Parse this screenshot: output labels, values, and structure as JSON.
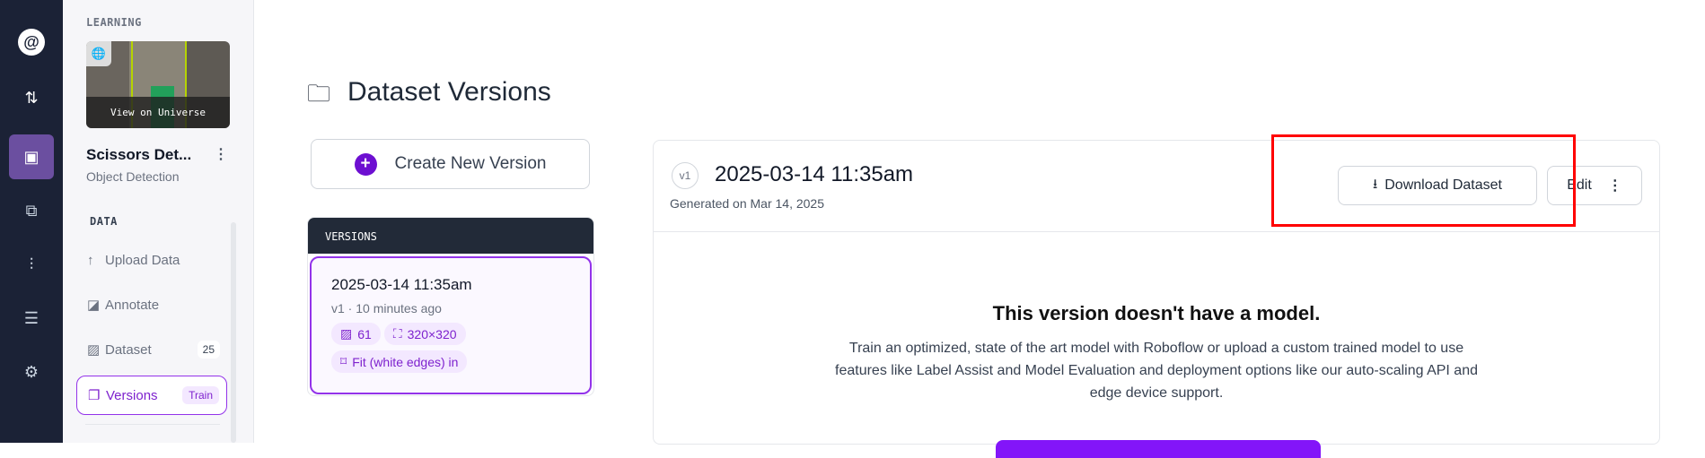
{
  "rail": {
    "items": [
      {
        "name": "logo-icon",
        "glyph": "@"
      },
      {
        "name": "upload-download-icon",
        "glyph": "⇅"
      },
      {
        "name": "data-icon",
        "glyph": "▣"
      },
      {
        "name": "workflow-icon",
        "glyph": "⧉"
      },
      {
        "name": "analytics-icon",
        "glyph": "⫶"
      },
      {
        "name": "storage-icon",
        "glyph": "☰"
      },
      {
        "name": "settings-icon",
        "glyph": "⚙"
      }
    ]
  },
  "panel": {
    "section_learning": "LEARNING",
    "thumb_caption": "View on Universe",
    "project_name": "Scissors Det...",
    "project_type": "Object Detection",
    "section_data": "DATA",
    "nav": [
      {
        "label": "Upload Data",
        "icon": "↑"
      },
      {
        "label": "Annotate",
        "icon": "◪"
      },
      {
        "label": "Dataset",
        "icon": "▨",
        "count": "25"
      },
      {
        "label": "Versions",
        "icon": "❐",
        "badge": "Train"
      }
    ]
  },
  "page": {
    "title": "Dataset Versions",
    "create_label": "Create New Version",
    "versions_header": "VERSIONS",
    "version_item": {
      "title": "2025-03-14 11:35am",
      "meta": "v1 · 10 minutes ago",
      "images": "61",
      "size": "320×320",
      "resize": "Fit (white edges) in"
    }
  },
  "detail": {
    "badge": "v1",
    "title": "2025-03-14 11:35am",
    "generated": "Generated on Mar 14, 2025",
    "download_label": "Download Dataset",
    "edit_label": "Edit",
    "empty_title": "This version doesn't have a model.",
    "empty_text": "Train an optimized, state of the art model with Roboflow or upload a custom trained model to use features like Label Assist and Model Evaluation and deployment options like our auto-scaling API and edge device support."
  },
  "colors": {
    "accent": "#7e22ce",
    "highlight": "#ff0000"
  }
}
